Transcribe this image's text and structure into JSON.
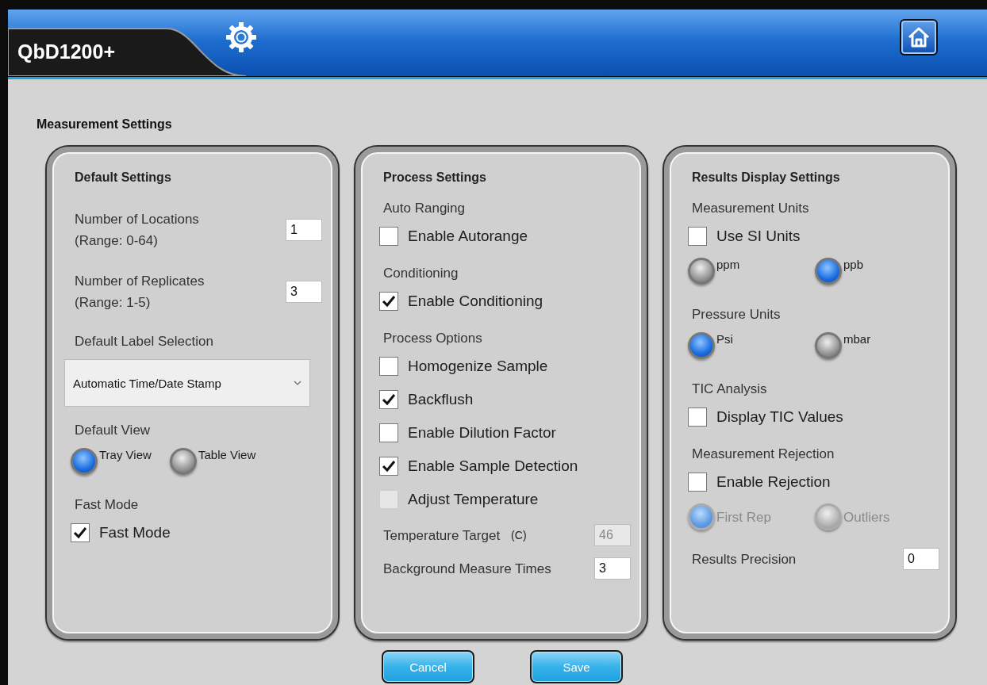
{
  "app": {
    "title": "QbD1200+"
  },
  "page_title": "Measurement Settings",
  "panels": [
    {
      "title": "Default Settings",
      "items": [
        {
          "kind": "field",
          "label": "Number of Locations",
          "note": "(Range: 0-64)",
          "value": "1",
          "disabled": false
        },
        {
          "kind": "field",
          "label": "Number of Replicates",
          "note": "(Range: 1-5)",
          "value": "3",
          "disabled": false
        },
        {
          "kind": "label",
          "text": "Default Label Selection"
        },
        {
          "kind": "select",
          "value": "Automatic Time/Date Stamp"
        },
        {
          "kind": "label",
          "text": "Default View"
        },
        {
          "kind": "radios",
          "disabled": false,
          "options": [
            {
              "label": "Tray View",
              "selected": true
            },
            {
              "label": "Table View",
              "selected": false
            }
          ]
        },
        {
          "kind": "label",
          "text": "Fast Mode"
        },
        {
          "kind": "checkbox",
          "label": "Fast Mode",
          "checked": true,
          "disabled": false
        }
      ]
    },
    {
      "title": "Process Settings",
      "items": [
        {
          "kind": "label",
          "text": "Auto Ranging"
        },
        {
          "kind": "checkbox",
          "label": "Enable Autorange",
          "checked": false,
          "disabled": false
        },
        {
          "kind": "label",
          "text": "Conditioning"
        },
        {
          "kind": "checkbox",
          "label": "Enable Conditioning",
          "checked": true,
          "disabled": false
        },
        {
          "kind": "label",
          "text": "Process Options"
        },
        {
          "kind": "checkbox",
          "label": "Homogenize Sample",
          "checked": false,
          "disabled": false
        },
        {
          "kind": "checkbox",
          "label": "Backflush",
          "checked": true,
          "disabled": false
        },
        {
          "kind": "checkbox",
          "label": "Enable Dilution Factor",
          "checked": false,
          "disabled": false
        },
        {
          "kind": "checkbox",
          "label": "Enable Sample Detection",
          "checked": true,
          "disabled": false
        },
        {
          "kind": "checkbox",
          "label": "Adjust Temperature",
          "checked": false,
          "disabled": true
        },
        {
          "kind": "field",
          "label": "Temperature Target",
          "unit": "(C)",
          "value": "46",
          "disabled": true
        },
        {
          "kind": "field",
          "label": "Background Measure Times",
          "value": "3",
          "disabled": false
        }
      ]
    },
    {
      "title": "Results Display Settings",
      "items": [
        {
          "kind": "label",
          "text": "Measurement Units"
        },
        {
          "kind": "checkbox",
          "label": "Use SI Units",
          "checked": false,
          "disabled": false
        },
        {
          "kind": "radios",
          "disabled": false,
          "options": [
            {
              "label": "ppm",
              "selected": false
            },
            {
              "label": "ppb",
              "selected": true
            }
          ]
        },
        {
          "kind": "label",
          "text": "Pressure Units"
        },
        {
          "kind": "radios",
          "disabled": false,
          "options": [
            {
              "label": "Psi",
              "selected": true
            },
            {
              "label": "mbar",
              "selected": false
            }
          ]
        },
        {
          "kind": "label",
          "text": "TIC Analysis"
        },
        {
          "kind": "checkbox",
          "label": "Display TIC Values",
          "checked": false,
          "disabled": false
        },
        {
          "kind": "label",
          "text": "Measurement Rejection"
        },
        {
          "kind": "checkbox",
          "label": "Enable Rejection",
          "checked": false,
          "disabled": false
        },
        {
          "kind": "radios",
          "disabled": true,
          "options": [
            {
              "label": "First Rep",
              "selected": true
            },
            {
              "label": "Outliers",
              "selected": false
            }
          ]
        },
        {
          "kind": "field",
          "label": "Results Precision",
          "value": "0",
          "disabled": false
        }
      ]
    }
  ],
  "buttons": [
    "Cancel",
    "Save"
  ]
}
